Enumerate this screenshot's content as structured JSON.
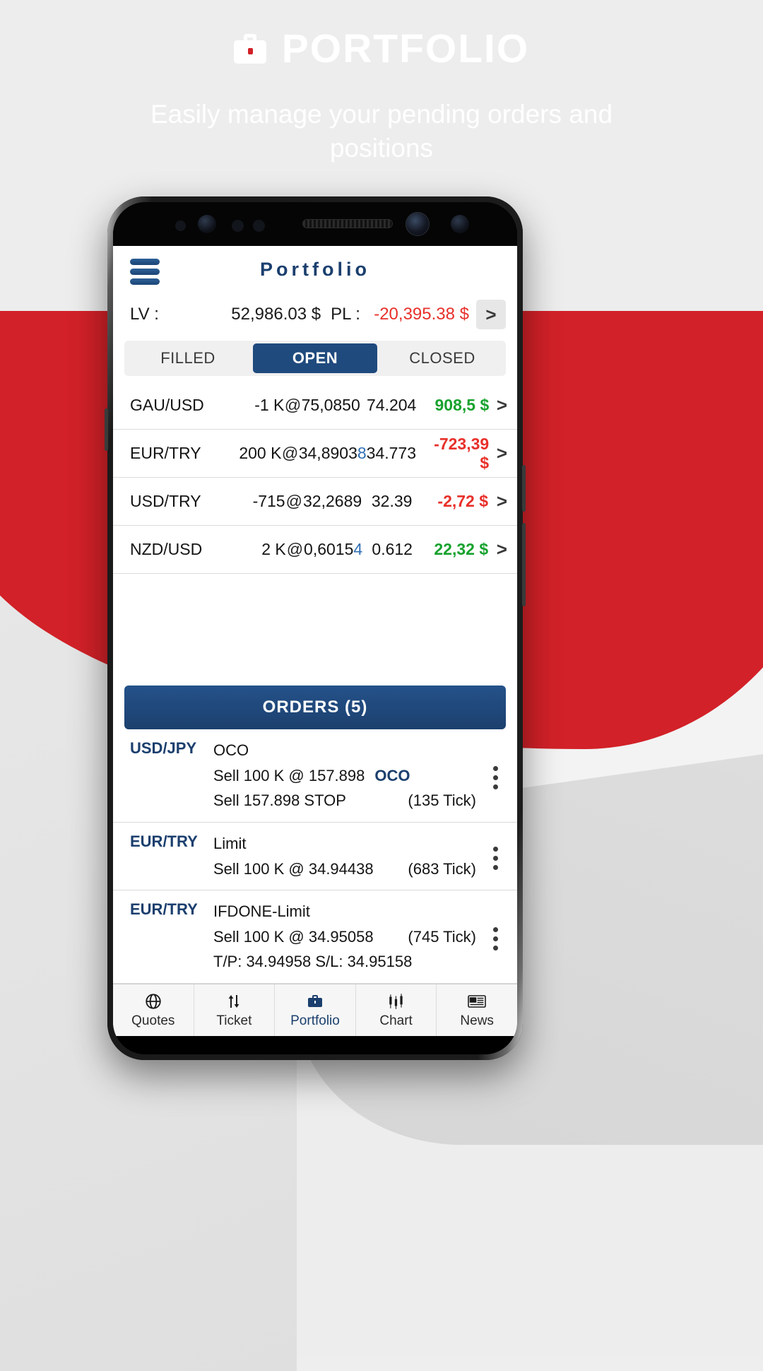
{
  "promo": {
    "title": "PORTFOLIO",
    "title_icon": "briefcase-icon",
    "subtitle": "Easily manage your pending orders and positions",
    "bg_color": "#d22128"
  },
  "app": {
    "title": "Portfolio",
    "menu_icon": "hamburger-menu-icon",
    "accent_color": "#1b3f6e",
    "summary": {
      "lv_label": "LV :",
      "lv_value": "52,986.03 $",
      "pl_label": "PL :",
      "pl_value": "-20,395.38 $",
      "pl_color": "#e8302a",
      "expand_icon": ">"
    },
    "tabs": [
      {
        "label": "FILLED",
        "active": false
      },
      {
        "label": "OPEN",
        "active": true
      },
      {
        "label": "CLOSED",
        "active": false
      }
    ],
    "positions": [
      {
        "symbol": "GAU/USD",
        "qty": "-1 K",
        "at": "@",
        "open_price": "75,0850",
        "open_price_highlight": "",
        "last_price": "74.204",
        "pl": "908,5 $",
        "pl_dir": "up",
        "chevron": ">"
      },
      {
        "symbol": "EUR/TRY",
        "qty": "200 K",
        "at": "@",
        "open_price": "34,8903",
        "open_price_highlight": "8",
        "last_price": "34.773",
        "pl": "-723,39 $",
        "pl_dir": "down",
        "chevron": ">"
      },
      {
        "symbol": "USD/TRY",
        "qty": "-715",
        "at": "@",
        "open_price": "32,2689",
        "open_price_highlight": "",
        "last_price": "32.39",
        "pl": "-2,72 $",
        "pl_dir": "down",
        "chevron": ">"
      },
      {
        "symbol": "NZD/USD",
        "qty": "2 K",
        "at": "@",
        "open_price": "0,6015",
        "open_price_highlight": "4",
        "last_price": "0.612",
        "pl": "22,32 $",
        "pl_dir": "up",
        "chevron": ">"
      }
    ],
    "orders_button": "ORDERS (5)",
    "orders": [
      {
        "symbol": "USD/JPY",
        "type": "OCO",
        "line2": "Sell 100 K  @  157.898",
        "line2_tag": "OCO",
        "line2_tick": "",
        "line3": "Sell 157.898 STOP",
        "line3_tick": "(135 Tick)",
        "line4": "",
        "menu_icon": "kebab-menu-icon"
      },
      {
        "symbol": "EUR/TRY",
        "type": "Limit",
        "line2": "Sell 100 K  @  34.94438",
        "line2_tag": "",
        "line2_tick": "(683 Tick)",
        "line3": "",
        "line3_tick": "",
        "line4": "",
        "menu_icon": "kebab-menu-icon"
      },
      {
        "symbol": "EUR/TRY",
        "type": "IFDONE-Limit",
        "line2": "Sell 100 K  @  34.95058",
        "line2_tag": "",
        "line2_tick": "(745 Tick)",
        "line3": "",
        "line3_tick": "",
        "line4": "T/P: 34.94958   S/L: 34.95158",
        "menu_icon": "kebab-menu-icon"
      }
    ],
    "bottom_nav": [
      {
        "label": "Quotes",
        "icon": "globe-icon",
        "active": false
      },
      {
        "label": "Ticket",
        "icon": "exchange-icon",
        "active": false
      },
      {
        "label": "Portfolio",
        "icon": "briefcase-icon",
        "active": true
      },
      {
        "label": "Chart",
        "icon": "candles-icon",
        "active": false
      },
      {
        "label": "News",
        "icon": "newspaper-icon",
        "active": false
      }
    ]
  }
}
